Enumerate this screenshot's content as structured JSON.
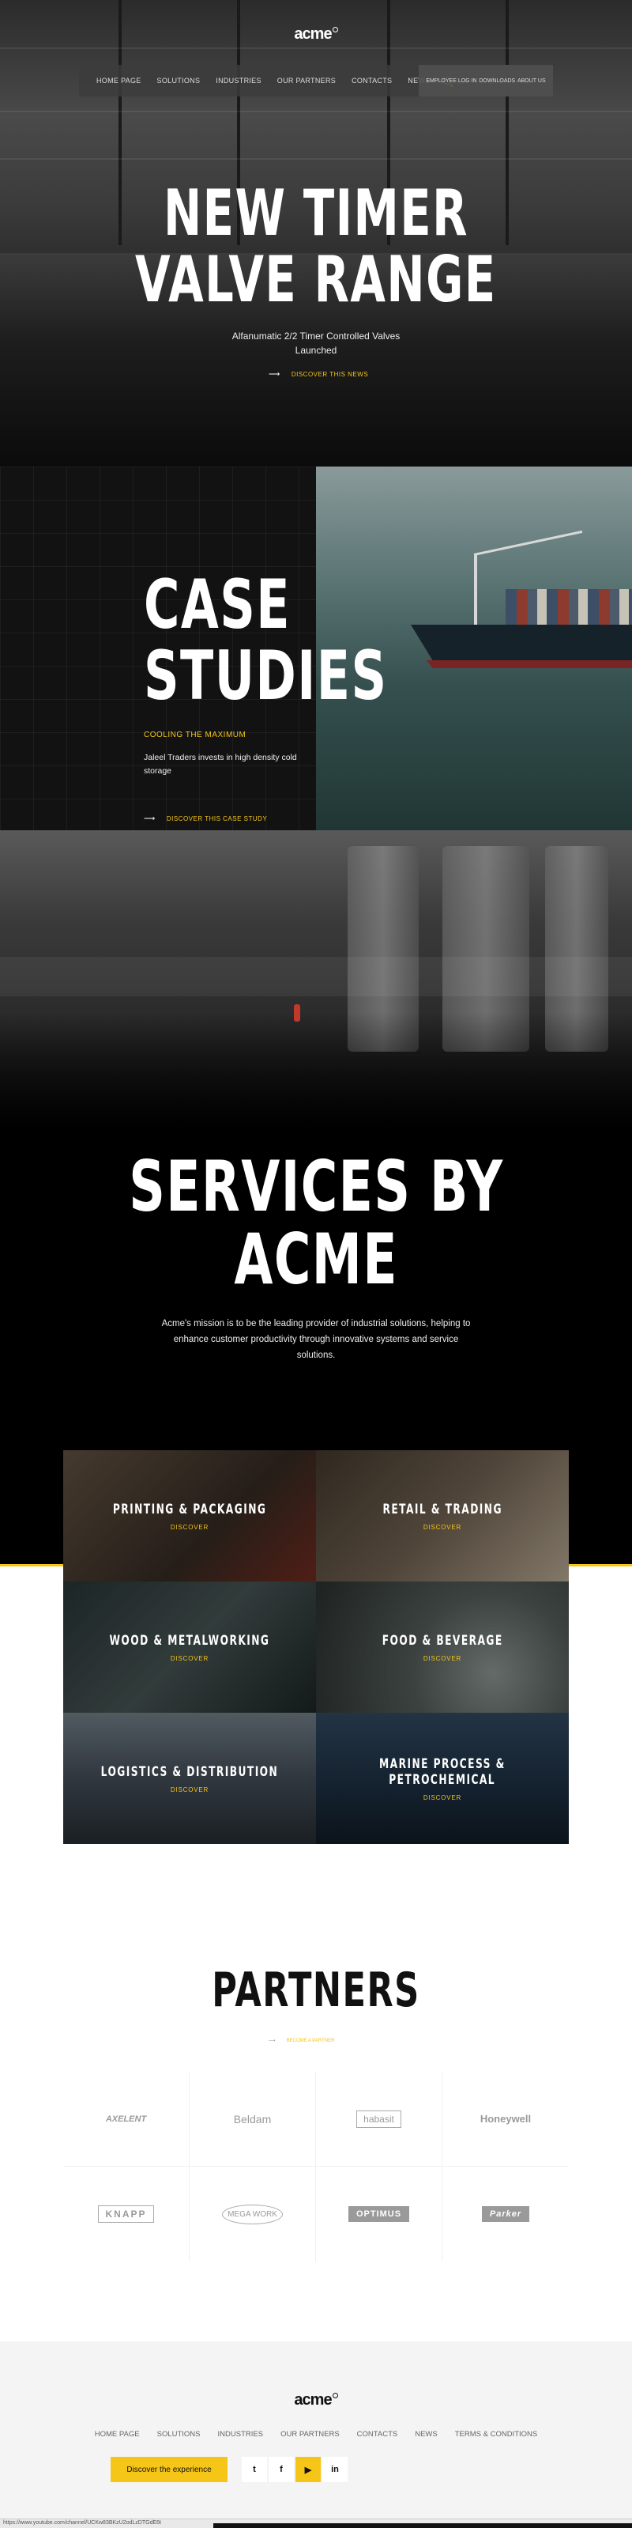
{
  "brand": {
    "logo": "acme"
  },
  "nav": {
    "items": [
      "HOME PAGE",
      "SOLUTIONS",
      "INDUSTRIES",
      "OUR PARTNERS",
      "CONTACTS",
      "NEWS"
    ],
    "search_icon": "search-icon",
    "right_items": [
      "EMPLOYEE LOG IN",
      "DOWNLOADS",
      "ABOUT US"
    ]
  },
  "hero": {
    "title_line1": "NEW TIMER",
    "title_line2": "VALVE RANGE",
    "subtitle_line1": "Alfanumatic 2/2 Timer Controlled Valves",
    "subtitle_line2": "Launched",
    "link": "DISCOVER THIS NEWS"
  },
  "case_study": {
    "title_line1": "CASE",
    "title_line2": "STUDIES",
    "kicker": "COOLING THE MAXIMUM",
    "text": "Jaleel Traders invests in high density cold storage",
    "link": "DISCOVER THIS CASE STUDY"
  },
  "services": {
    "title_line1": "SERVICES BY",
    "title_line2": "ACME",
    "text": "Acme's mission is to be the leading provider of industrial solutions, helping to enhance customer productivity through innovative systems and service solutions.",
    "tiles": [
      {
        "name_line1": "PRINTING & PACKAGING",
        "name_line2": "",
        "link": "DISCOVER"
      },
      {
        "name_line1": "RETAIL & TRADING",
        "name_line2": "",
        "link": "DISCOVER"
      },
      {
        "name_line1": "WOOD & METALWORKING",
        "name_line2": "",
        "link": "DISCOVER"
      },
      {
        "name_line1": "FOOD & BEVERAGE",
        "name_line2": "",
        "link": "DISCOVER"
      },
      {
        "name_line1": "LOGISTICS & DISTRIBUTION",
        "name_line2": "",
        "link": "DISCOVER"
      },
      {
        "name_line1": "MARINE PROCESS &",
        "name_line2": "PETROCHEMICAL",
        "link": "DISCOVER"
      }
    ]
  },
  "partners": {
    "title": "PARTNERS",
    "link": "BECOME A PARTNER",
    "logos": [
      "AXELENT",
      "Beldam",
      "habasit",
      "Honeywell",
      "KNAPP",
      "MEGA WORK",
      "OPTIMUS",
      "Parker"
    ]
  },
  "footer": {
    "logo": "acme",
    "nav": [
      "HOME PAGE",
      "SOLUTIONS",
      "INDUSTRIES",
      "OUR PARTNERS",
      "CONTACTS",
      "NEWS",
      "TERMS & CONDITIONS"
    ],
    "cta": "Discover the experience",
    "social": [
      "twitter-icon",
      "facebook-icon",
      "youtube-icon",
      "linkedin-icon"
    ],
    "status_url": "https://www.youtube.com/channel/UCKw83BKzU2odLzDTGdE6t"
  },
  "colors": {
    "accent": "#f5c518",
    "dark": "#000000",
    "footer_bg": "#f4f4f4"
  }
}
